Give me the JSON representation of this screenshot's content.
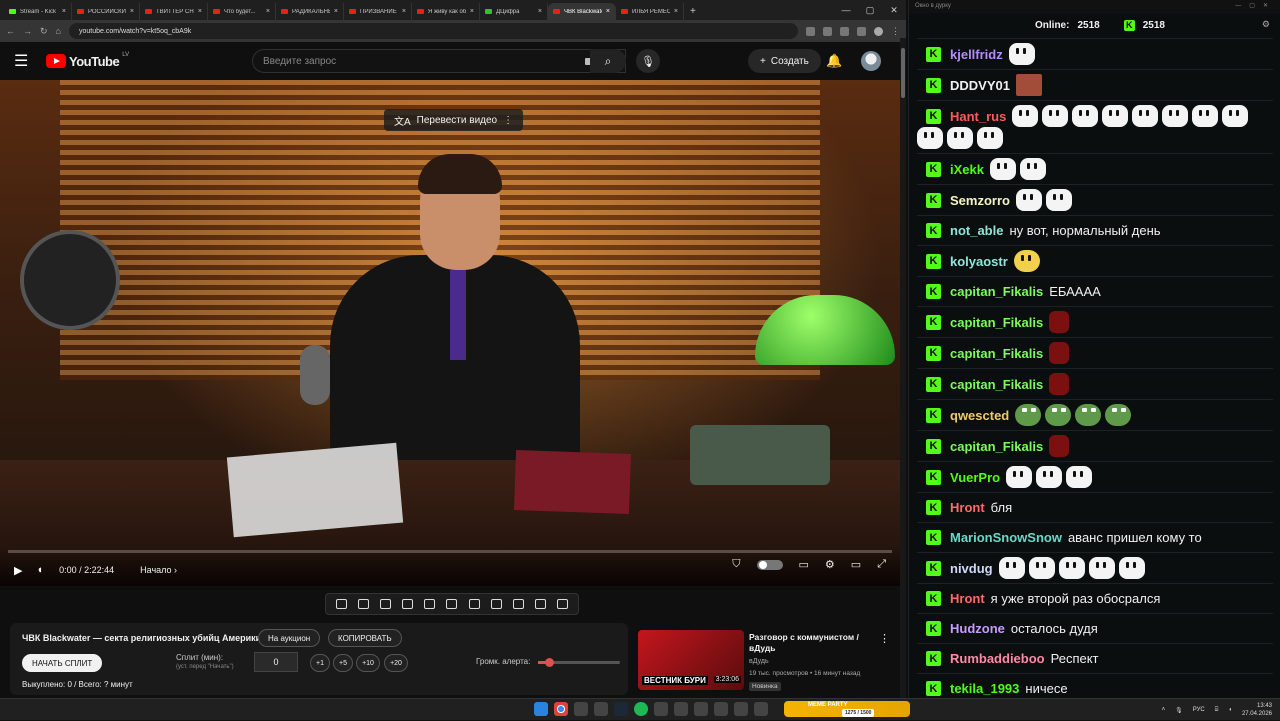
{
  "browser": {
    "tabs": [
      {
        "label": "Stream - Kick D",
        "fav": "kick",
        "active": false
      },
      {
        "label": "РОССИЙСКИЕ",
        "fav": "yt",
        "active": false
      },
      {
        "label": "ТВИТТЕР СНЕС",
        "fav": "yt",
        "active": false
      },
      {
        "label": "Что будет...",
        "fav": "yt",
        "active": false
      },
      {
        "label": "РАДИКАЛЬНЫЙ",
        "fav": "yt",
        "active": false
      },
      {
        "label": "ПРИЗВАНИЕ П",
        "fav": "yt",
        "active": false
      },
      {
        "label": "Я живу как об",
        "fav": "yt",
        "active": false
      },
      {
        "label": "ДЦифра",
        "fav": "green",
        "active": false
      },
      {
        "label": "ЧВК Blackwater",
        "fav": "yt",
        "active": true
      },
      {
        "label": "ИЛЬЯ РЕМЕСЛ",
        "fav": "yt",
        "active": false
      }
    ],
    "new_tab": "+",
    "url": "youtube.com/watch?v=kt5oq_cbA9k"
  },
  "youtube": {
    "logo_text": "YouTube",
    "region": "LV",
    "search_placeholder": "Введите запрос",
    "create_label": "Создать",
    "translate_label": "Перевести видео",
    "time": "0:00 / 2:22:44",
    "chapter": "Начало",
    "progress": 0.0
  },
  "panel": {
    "title": "ЧВК Blackwater — секта религиозных убийц Америки!",
    "auction": "На аукцион",
    "copy": "КОПИРОВАТЬ",
    "start_split": "НАЧАТЬ СПЛИТ",
    "split_label": "Сплит (мин):",
    "split_hint": "(уст. перед \"Начать\")",
    "split_value": "0",
    "steps": [
      "+1",
      "+5",
      "+10",
      "+20"
    ],
    "volume_label": "Громк. алерта:",
    "volume": 0.14,
    "bought": "Выкуплено: 0 / Всего: ? минут"
  },
  "recommendation": {
    "title": "Разговор с коммунистом / вДудь",
    "channel": "вДудь",
    "meta": "19 тыс. просмотров • 16 минут назад",
    "badge": "Новинка",
    "thumb_text": "ВЕСТНИК БУРИ",
    "duration": "3:23:06"
  },
  "chat": {
    "window_title": "Окно в дурку",
    "online_label": "Online:",
    "online_count": "2518",
    "viewers": "2518",
    "messages": [
      {
        "user": "kjellfridz",
        "color": "#b58cff",
        "text": "",
        "emotes": [
          "pepe"
        ]
      },
      {
        "user": "DDDVY01",
        "color": "#f1f1f1",
        "text": "",
        "emotes": [
          "face"
        ]
      },
      {
        "user": "Hant_rus",
        "color": "#ff5a5a",
        "text": "",
        "emotes": [
          "pepe",
          "pepe",
          "pepe",
          "pepe",
          "pepe",
          "pepe",
          "pepe",
          "pepe",
          "pepe",
          "pepe",
          "pepe"
        ]
      },
      {
        "user": "iXekk",
        "color": "#53fc18",
        "text": "",
        "emotes": [
          "pepe",
          "pepe"
        ]
      },
      {
        "user": "Semzorro",
        "color": "#f5f5c0",
        "text": "",
        "emotes": [
          "pepe",
          "pepe"
        ]
      },
      {
        "user": "not_able",
        "color": "#8ee6d8",
        "text": "ну вот, нормальный день",
        "emotes": []
      },
      {
        "user": "kolyaostr",
        "color": "#8ee6d8",
        "text": "",
        "emotes": [
          "bee"
        ]
      },
      {
        "user": "capitan_Fikalis",
        "color": "#7cfc5c",
        "text": "ЕБАААА",
        "emotes": []
      },
      {
        "user": "capitan_Fikalis",
        "color": "#7cfc5c",
        "text": "",
        "emotes": [
          "red"
        ]
      },
      {
        "user": "capitan_Fikalis",
        "color": "#7cfc5c",
        "text": "",
        "emotes": [
          "red"
        ]
      },
      {
        "user": "capitan_Fikalis",
        "color": "#7cfc5c",
        "text": "",
        "emotes": [
          "red"
        ]
      },
      {
        "user": "qwescted",
        "color": "#f2c96a",
        "text": "",
        "emotes": [
          "frog",
          "frog",
          "frog",
          "frog"
        ]
      },
      {
        "user": "capitan_Fikalis",
        "color": "#7cfc5c",
        "text": "",
        "emotes": [
          "red"
        ]
      },
      {
        "user": "VuerPro",
        "color": "#53fc18",
        "text": "",
        "emotes": [
          "pepe",
          "pepe",
          "pepe"
        ]
      },
      {
        "user": "Hront",
        "color": "#ff6a6a",
        "text": "бля",
        "emotes": []
      },
      {
        "user": "MarionSnowSnow",
        "color": "#6ad8c8",
        "text": "аванс пришел кому то",
        "emotes": []
      },
      {
        "user": "nivdug",
        "color": "#cfd8ff",
        "text": "",
        "emotes": [
          "pepe",
          "pepe",
          "pepe",
          "pepe",
          "pepe"
        ]
      },
      {
        "user": "Hront",
        "color": "#ff6a6a",
        "text": "я уже второй раз обосрался",
        "emotes": []
      },
      {
        "user": "Hudzone",
        "color": "#c69cff",
        "text": "осталось дудя",
        "emotes": []
      },
      {
        "user": "Rumbaddieboo",
        "color": "#ff8aa8",
        "text": "Респект",
        "emotes": []
      },
      {
        "user": "tekila_1993",
        "color": "#53fc18",
        "text": "ничесе",
        "emotes": []
      }
    ]
  },
  "taskbar": {
    "meme_party": "MEME PARTY",
    "meme_count": "1275 / 1500",
    "lang": "РУС",
    "time": "13:43",
    "date": "27.04.2026"
  }
}
